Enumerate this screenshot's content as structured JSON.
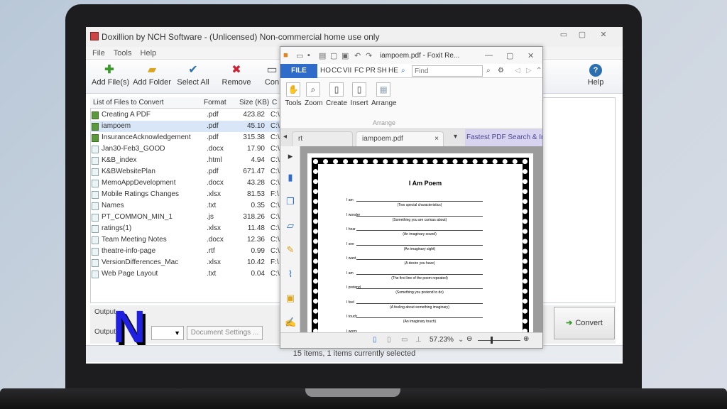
{
  "window": {
    "title": "Doxillion by NCH Software - (Unlicensed) Non-commercial home use only",
    "controls": [
      "▭",
      "▢",
      "✕"
    ]
  },
  "menu": [
    "File",
    "Tools",
    "Help"
  ],
  "toolbar": {
    "add_files": "Add File(s)",
    "add_folder": "Add Folder",
    "select_all": "Select All",
    "remove": "Remove",
    "convert_partial": "Con",
    "help": "Help"
  },
  "list": {
    "headers": {
      "name": "List of Files to Convert",
      "format": "Format",
      "size": "Size (KB)",
      "path": "C"
    },
    "rows": [
      {
        "name": "Creating A PDF",
        "format": ".pdf",
        "size": "423.82",
        "path": "C:\\",
        "checked": true,
        "selected": false
      },
      {
        "name": "iampoem",
        "format": ".pdf",
        "size": "45.10",
        "path": "C:\\",
        "checked": true,
        "selected": true
      },
      {
        "name": "InsuranceAcknowledgement",
        "format": ".pdf",
        "size": "315.38",
        "path": "C:\\",
        "checked": true,
        "selected": false
      },
      {
        "name": "Jan30-Feb3_GOOD",
        "format": ".docx",
        "size": "17.90",
        "path": "C:\\",
        "checked": false,
        "selected": false
      },
      {
        "name": "K&B_index",
        "format": ".html",
        "size": "4.94",
        "path": "C:\\",
        "checked": false,
        "selected": false
      },
      {
        "name": "K&BWebsitePlan",
        "format": ".pdf",
        "size": "671.47",
        "path": "C:\\",
        "checked": false,
        "selected": false
      },
      {
        "name": "MemoAppDevelopment",
        "format": ".docx",
        "size": "43.28",
        "path": "C:\\",
        "checked": false,
        "selected": false
      },
      {
        "name": "Mobile Ratings Changes",
        "format": ".xlsx",
        "size": "81.53",
        "path": "F:\\",
        "checked": false,
        "selected": false
      },
      {
        "name": "Names",
        "format": ".txt",
        "size": "0.35",
        "path": "C:\\",
        "checked": false,
        "selected": false
      },
      {
        "name": "PT_COMMON_MIN_1",
        "format": ".js",
        "size": "318.26",
        "path": "C:\\",
        "checked": false,
        "selected": false
      },
      {
        "name": "ratings(1)",
        "format": ".xlsx",
        "size": "11.48",
        "path": "C:\\",
        "checked": false,
        "selected": false
      },
      {
        "name": "Team Meeting Notes",
        "format": ".docx",
        "size": "12.36",
        "path": "C:\\",
        "checked": false,
        "selected": false
      },
      {
        "name": "theatre-info-page",
        "format": ".rtf",
        "size": "0.99",
        "path": "C:\\",
        "checked": false,
        "selected": false
      },
      {
        "name": "VersionDifferences_Mac",
        "format": ".xlsx",
        "size": "10.42",
        "path": "F:\\",
        "checked": false,
        "selected": false
      },
      {
        "name": "Web Page Layout",
        "format": ".txt",
        "size": "0.04",
        "path": "C:\\",
        "checked": false,
        "selected": false
      }
    ]
  },
  "bottom": {
    "output_label_1": "Output",
    "output_label_2": "Output",
    "document_settings": "Document Settings ...",
    "convert": "Convert"
  },
  "status": "15 items, 1 items currently selected",
  "foxit": {
    "title": "iampoem.pdf - Foxit Re...",
    "file_tab": "FILE",
    "tabs": [
      "HO",
      "CC",
      "VII",
      "FC",
      "PR",
      "SH",
      "HE"
    ],
    "find_placeholder": "Find",
    "ribbon": [
      "Tools",
      "Zoom",
      "Create",
      "Insert",
      "Arrange"
    ],
    "ribbon_group": "Arrange",
    "doc_tab_prev": "rt",
    "doc_tab_active": "iampoem.pdf",
    "ad_tab": "Fastest PDF Search & Index",
    "zoom": "57.23%",
    "page": {
      "title": "I Am Poem",
      "lines": [
        {
          "lead": "I am",
          "hint": "(Two special characteristics)"
        },
        {
          "lead": "I wonder",
          "hint": "(Something you are curious about)"
        },
        {
          "lead": "I hear",
          "hint": "(An imaginary sound)"
        },
        {
          "lead": "I see",
          "hint": "(An imaginary sight)"
        },
        {
          "lead": "I want",
          "hint": "(A desire you have)"
        },
        {
          "lead": "I am",
          "hint": "(The first line of the poem repeated)"
        },
        {
          "lead": "I pretend",
          "hint": "(Something you pretend to do)"
        },
        {
          "lead": "I feel",
          "hint": "(A feeling about something imaginary)"
        },
        {
          "lead": "I touch",
          "hint": "(An imaginary touch)"
        },
        {
          "lead": "I worry",
          "hint": ""
        }
      ]
    }
  },
  "logo_letter": "N",
  "colors": {
    "accent": "#2f6cc9",
    "logo": "#2020e0",
    "selection": "#d8e6f8"
  }
}
